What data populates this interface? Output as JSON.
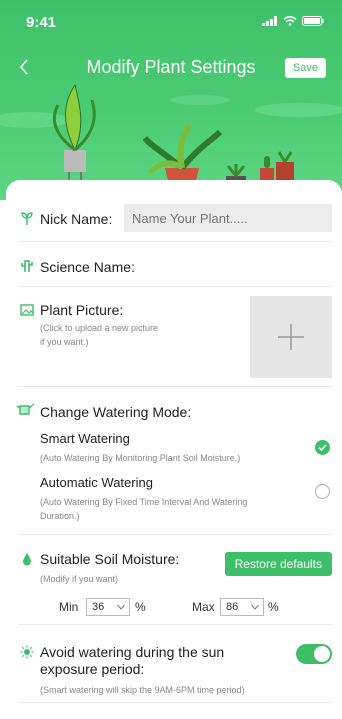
{
  "status_bar": {
    "time": "9:41"
  },
  "header": {
    "title": "Modify Plant Settings",
    "save_label": "Save"
  },
  "nick_name": {
    "label": "Nick Name:",
    "placeholder": "Name Your Plant....."
  },
  "science_name": {
    "label": "Science Name:"
  },
  "plant_picture": {
    "label": "Plant Picture:",
    "hint_line1": "(Click to upload a new picture",
    "hint_line2": "if you want.)"
  },
  "watering_mode": {
    "label": "Change Watering Mode:",
    "options": [
      {
        "label": "Smart Watering",
        "desc": "(Auto Watering By Monitoring Plant Soil Moisture.)",
        "selected": true
      },
      {
        "label": "Automatic Watering",
        "desc_line1": "(Auto Watering By Fixed Time Interval And Watering",
        "desc_line2": "Duration.)",
        "selected": false
      }
    ]
  },
  "soil_moisture": {
    "label": "Suitable Soil Moisture:",
    "hint": "(Modify if you want)",
    "restore_label": "Restore defaults",
    "min_label": "Min",
    "min_value": "36",
    "max_label": "Max",
    "max_value": "86",
    "unit": "%"
  },
  "sun_exposure": {
    "label_line1": "Avoid watering during the sun",
    "label_line2": "exposure period:",
    "hint": "(Smart watering will skip the 9AM-6PM time period)",
    "enabled": true
  },
  "colors": {
    "accent": "#3cbf67",
    "header": "#4ccd74"
  }
}
